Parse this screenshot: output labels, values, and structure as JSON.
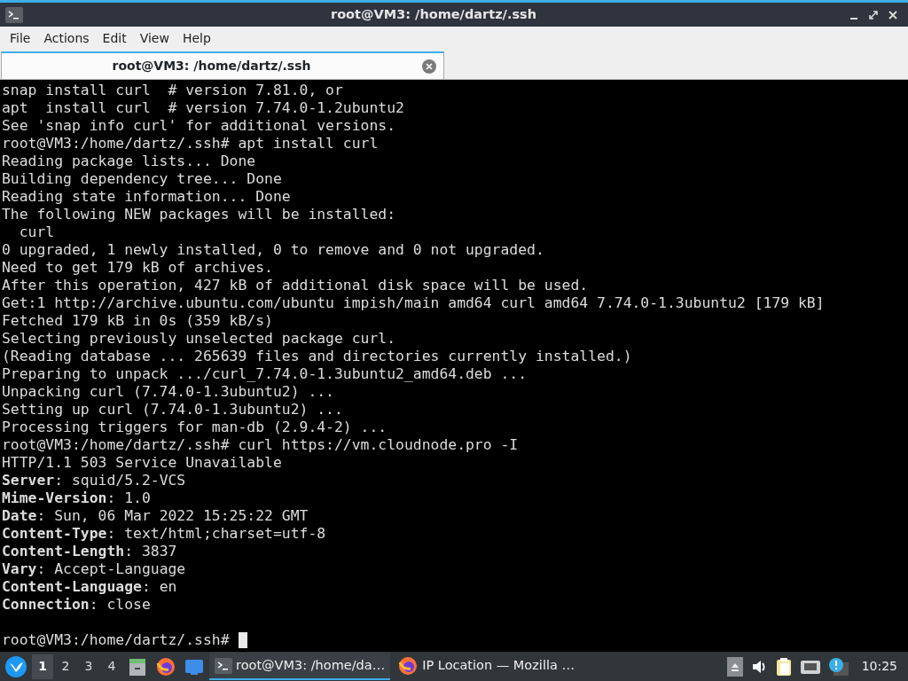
{
  "window": {
    "title": "root@VM3: /home/dartz/.ssh"
  },
  "menu": [
    "File",
    "Actions",
    "Edit",
    "View",
    "Help"
  ],
  "tabs": [
    {
      "label": "root@VM3: /home/dartz/.ssh",
      "selected": true
    }
  ],
  "terminal": {
    "lines": [
      {
        "kind": "text",
        "text": "snap install curl  # version 7.81.0, or"
      },
      {
        "kind": "text",
        "text": "apt  install curl  # version 7.74.0-1.2ubuntu2"
      },
      {
        "kind": "text",
        "text": "See 'snap info curl' for additional versions."
      },
      {
        "kind": "text",
        "text": "root@VM3:/home/dartz/.ssh# apt install curl"
      },
      {
        "kind": "text",
        "text": "Reading package lists... Done"
      },
      {
        "kind": "text",
        "text": "Building dependency tree... Done"
      },
      {
        "kind": "text",
        "text": "Reading state information... Done"
      },
      {
        "kind": "text",
        "text": "The following NEW packages will be installed:"
      },
      {
        "kind": "text",
        "text": "  curl"
      },
      {
        "kind": "text",
        "text": "0 upgraded, 1 newly installed, 0 to remove and 0 not upgraded."
      },
      {
        "kind": "text",
        "text": "Need to get 179 kB of archives."
      },
      {
        "kind": "text",
        "text": "After this operation, 427 kB of additional disk space will be used."
      },
      {
        "kind": "text",
        "text": "Get:1 http://archive.ubuntu.com/ubuntu impish/main amd64 curl amd64 7.74.0-1.3ubuntu2 [179 kB]"
      },
      {
        "kind": "text",
        "text": "Fetched 179 kB in 0s (359 kB/s)"
      },
      {
        "kind": "text",
        "text": "Selecting previously unselected package curl."
      },
      {
        "kind": "text",
        "text": "(Reading database ... 265639 files and directories currently installed.)"
      },
      {
        "kind": "text",
        "text": "Preparing to unpack .../curl_7.74.0-1.3ubuntu2_amd64.deb ..."
      },
      {
        "kind": "text",
        "text": "Unpacking curl (7.74.0-1.3ubuntu2) ..."
      },
      {
        "kind": "text",
        "text": "Setting up curl (7.74.0-1.3ubuntu2) ..."
      },
      {
        "kind": "text",
        "text": "Processing triggers for man-db (2.9.4-2) ..."
      },
      {
        "kind": "text",
        "text": "root@VM3:/home/dartz/.ssh# curl https://vm.cloudnode.pro -I"
      },
      {
        "kind": "text",
        "text": "HTTP/1.1 503 Service Unavailable"
      },
      {
        "kind": "text",
        "text": "**Server**: squid/5.2-VCS"
      },
      {
        "kind": "text",
        "text": "**Mime-Version**: 1.0"
      },
      {
        "kind": "text",
        "text": "**Date**: Sun, 06 Mar 2022 15:25:22 GMT"
      },
      {
        "kind": "text",
        "text": "**Content-Type**: text/html;charset=utf-8"
      },
      {
        "kind": "text",
        "text": "**Content-Length**: 3837"
      },
      {
        "kind": "text",
        "text": "**Vary**: Accept-Language"
      },
      {
        "kind": "text",
        "text": "**Content-Language**: en"
      },
      {
        "kind": "text",
        "text": "**Connection**: close"
      },
      {
        "kind": "blank"
      },
      {
        "kind": "prompt",
        "text": "root@VM3:/home/dartz/.ssh#"
      }
    ]
  },
  "taskbar": {
    "desktops": [
      {
        "label": "1",
        "selected": true
      },
      {
        "label": "2",
        "selected": false
      },
      {
        "label": "3",
        "selected": false
      },
      {
        "label": "4",
        "selected": false
      }
    ],
    "tasks": [
      {
        "kind": "terminal",
        "label": "root@VM3: /home/da…",
        "selected": true
      },
      {
        "kind": "browser",
        "label": "IP Location — Mozilla …",
        "selected": false
      }
    ],
    "clock": "10:25"
  }
}
